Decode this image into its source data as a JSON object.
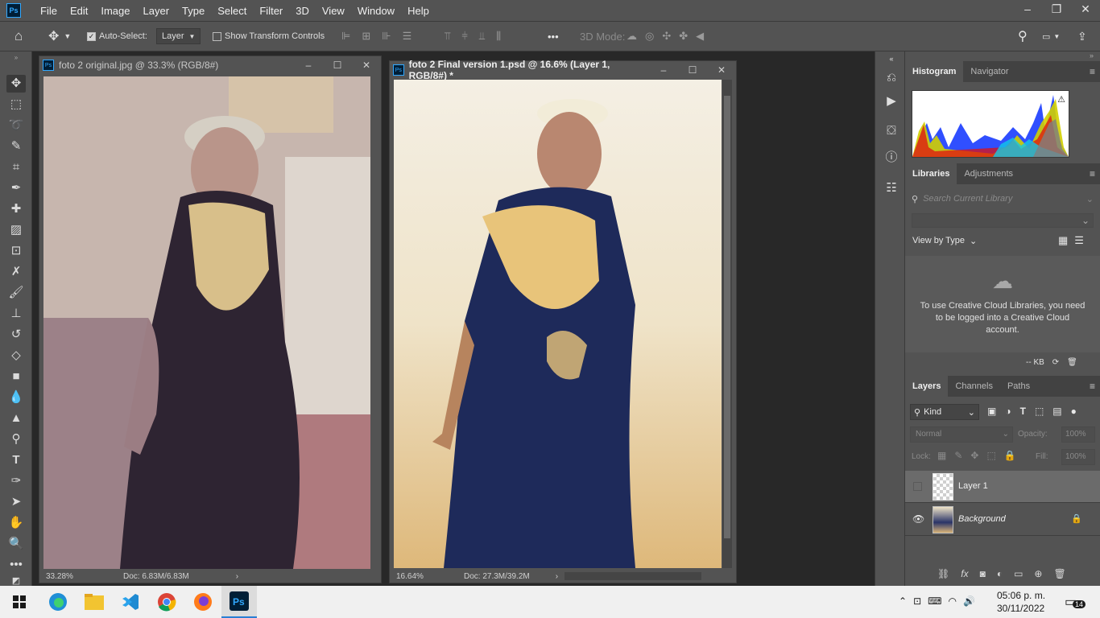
{
  "menu": {
    "items": [
      "File",
      "Edit",
      "Image",
      "Layer",
      "Type",
      "Select",
      "Filter",
      "3D",
      "View",
      "Window",
      "Help"
    ]
  },
  "options": {
    "auto_select_label": "Auto-Select:",
    "auto_select_target": "Layer",
    "show_transform_label": "Show Transform Controls",
    "mode_3d_label": "3D Mode:",
    "more": "•••"
  },
  "doc1": {
    "title": "foto 2 original.jpg @ 33.3% (RGB/8#)",
    "zoom": "33.28%",
    "doc_size": "Doc: 6.83M/6.83M"
  },
  "doc2": {
    "title": "foto 2 Final version 1.psd @ 16.6% (Layer 1, RGB/8#) *",
    "zoom": "16.64%",
    "doc_size": "Doc: 27.3M/39.2M"
  },
  "histogram": {
    "tabs": [
      "Histogram",
      "Navigator"
    ]
  },
  "libraries": {
    "tabs": [
      "Libraries",
      "Adjustments"
    ],
    "search_placeholder": "Search Current Library",
    "view_by": "View by Type",
    "message": "To use Creative Cloud Libraries, you need to be logged into a Creative Cloud account.",
    "size": "-- KB"
  },
  "layers": {
    "tabs": [
      "Layers",
      "Channels",
      "Paths"
    ],
    "filter_kind": "Kind",
    "blend_mode": "Normal",
    "opacity_label": "Opacity:",
    "opacity_value": "100%",
    "lock_label": "Lock:",
    "fill_label": "Fill:",
    "fill_value": "100%",
    "items": [
      {
        "name": "Layer 1"
      },
      {
        "name": "Background"
      }
    ]
  },
  "taskbar": {
    "time": "05:06 p. m.",
    "date": "30/11/2022",
    "notif_count": "14"
  }
}
